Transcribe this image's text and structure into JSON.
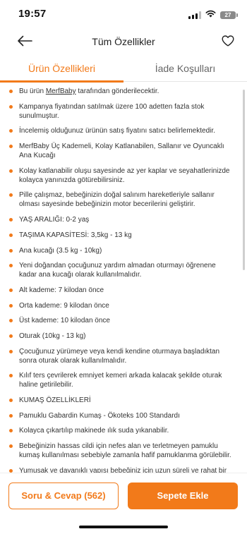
{
  "status_bar": {
    "time": "19:57",
    "battery": "27",
    "icons": [
      "signal-icon",
      "wifi-icon",
      "battery-icon"
    ]
  },
  "nav": {
    "title": "Tüm Özellikler",
    "back_icon": "arrow-left-icon",
    "favorite_icon": "heart-outline-icon"
  },
  "tabs": [
    {
      "label": "Ürün Özellikleri",
      "active": true
    },
    {
      "label": "İade Koşulları",
      "active": false
    }
  ],
  "features": [
    {
      "segments": [
        "Bu ürün ",
        "MerfBaby",
        " tarafından gönderilecektir."
      ]
    },
    {
      "text": "Kampanya fiyatından satılmak üzere 100 adetten fazla stok sunulmuştur."
    },
    {
      "text": "İncelemiş olduğunuz ürünün satış fiyatını satıcı belirlemektedir."
    },
    {
      "text": "MerfBaby Üç Kademeli, Kolay Katlanabilen, Sallanır ve Oyuncaklı Ana Kucağı"
    },
    {
      "text": "Kolay katlanabilir oluşu sayesinde az yer kaplar ve seyahatlerinizde kolayca yanınızda götürebilirsiniz."
    },
    {
      "text": "Pille çalışmaz, bebeğinizin doğal salınım hareketleriyle sallanır olması sayesinde bebeğinizin motor becerilerini geliştirir."
    },
    {
      "text": "YAŞ ARALIĞI: 0-2 yaş"
    },
    {
      "text": "TAŞIMA KAPASİTESİ: 3,5kg - 13 kg"
    },
    {
      "text": "Ana kucağı (3.5 kg - 10kg)"
    },
    {
      "text": "Yeni doğandan çocuğunuz yardım almadan oturmayı öğrenene kadar ana kucağı olarak kullanılmalıdır."
    },
    {
      "text": "Alt kademe: 7 kilodan önce"
    },
    {
      "text": "Orta kademe: 9 kilodan önce"
    },
    {
      "text": "Üst kademe: 10 kilodan önce"
    },
    {
      "text": "Oturak (10kg - 13 kg)"
    },
    {
      "text": "Çocuğunuz yürümeye veya kendi kendine oturmaya başladıktan sonra oturak olarak kullanılmalıdır."
    },
    {
      "text": "Kılıf ters çevrilerek emniyet kemeri arkada kalacak şekilde oturak haline getirilebilir."
    },
    {
      "text": "KUMAŞ ÖZELLİKLERİ"
    },
    {
      "text": "Pamuklu Gabardin Kumaş - Ökoteks 100 Standardı"
    },
    {
      "text": "Kolayca çıkartılıp makinede ılık suda yıkanabilir."
    },
    {
      "text": "Bebeğinizin hassas cildi için nefes alan ve terletmeyen pamuklu kumaş kullanılması sebebiyle zamanla hafif pamuklanma görülebilir."
    },
    {
      "text": "Yumuşak ve dayanıklı yapısı bebeğiniz için uzun süreli ve rahat bir kullanım sunar."
    }
  ],
  "bottom": {
    "qa_label": "Soru & Cevap (562)",
    "cart_label": "Sepete Ekle"
  },
  "colors": {
    "accent": "#f27a1a",
    "text": "#333333",
    "muted": "#666666"
  }
}
